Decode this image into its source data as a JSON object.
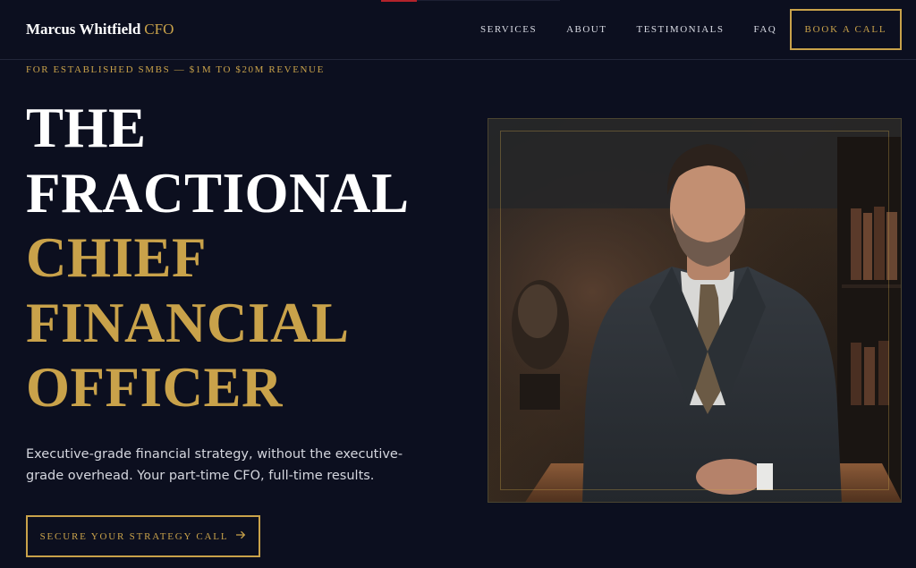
{
  "header": {
    "brand_name": "Marcus Whitfield",
    "brand_suffix": "CFO",
    "nav": [
      "SERVICES",
      "ABOUT",
      "TESTIMONIALS",
      "FAQ"
    ],
    "book_button": "BOOK A CALL"
  },
  "hero": {
    "eyebrow": "FOR ESTABLISHED SMBS — $1M TO $20M REVENUE",
    "headline_white": [
      "THE",
      "FRACTIONAL"
    ],
    "headline_gold": [
      "CHIEF",
      "FINANCIAL",
      "OFFICER"
    ],
    "subtext": "Executive-grade financial strategy, without the executive-grade overhead. Your part-time CFO, full-time results.",
    "cta_label": "SECURE YOUR STRATEGY CALL",
    "cta_icon": "arrow-right-icon"
  },
  "colors": {
    "background": "#0c0f1f",
    "gold": "#c9a24a",
    "text": "#ffffff"
  }
}
